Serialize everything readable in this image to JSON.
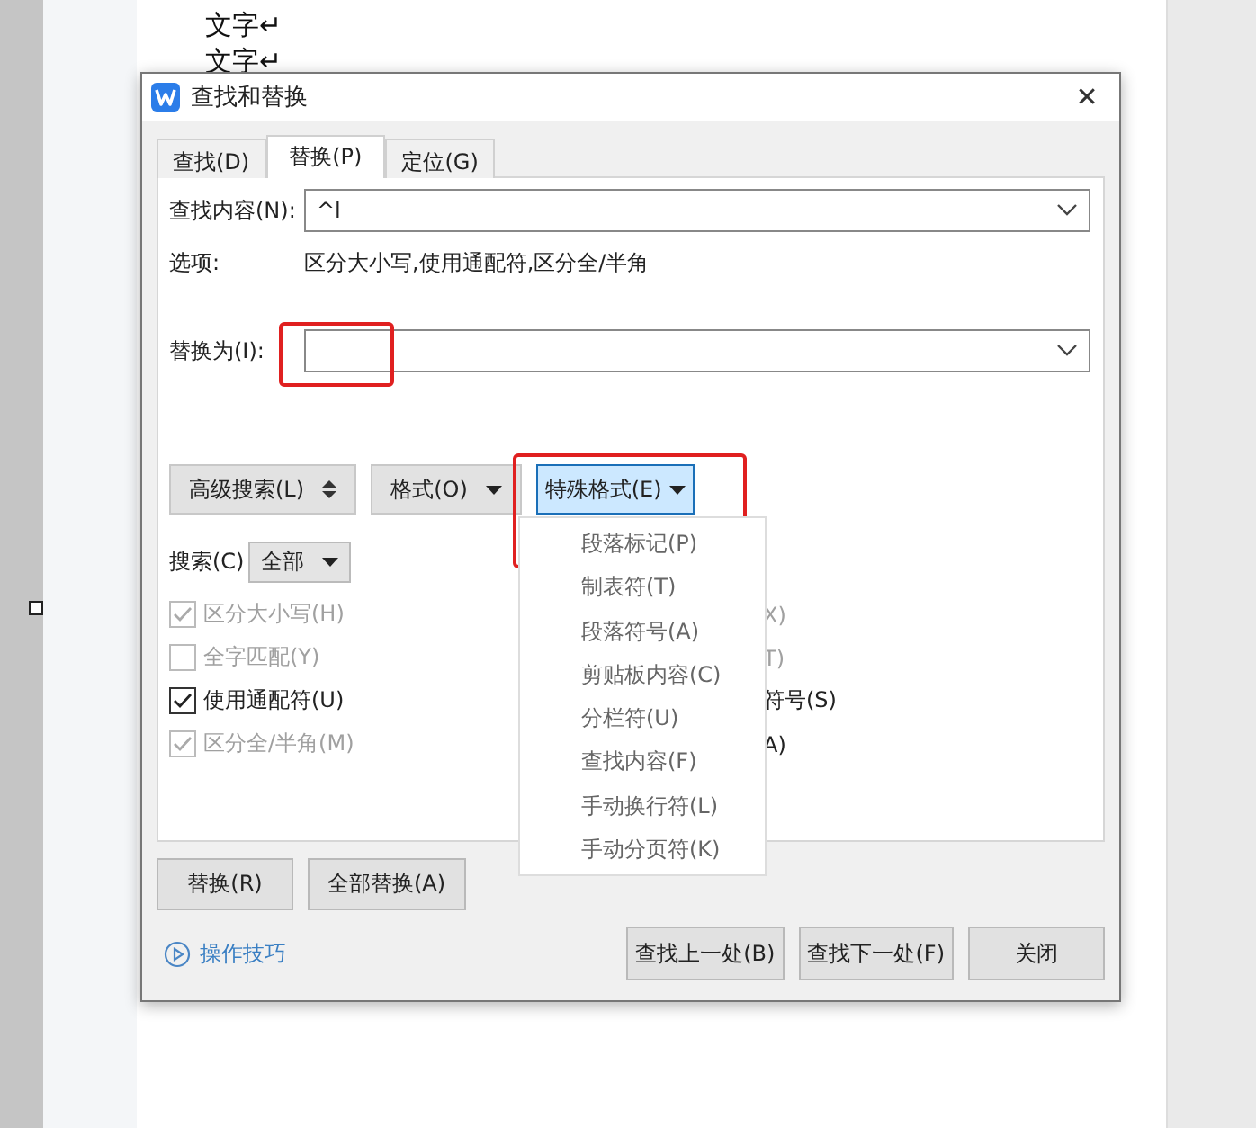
{
  "document": {
    "lines": [
      "文字↵",
      "文字↵"
    ]
  },
  "dialog": {
    "title": "查找和替换",
    "close": "✕",
    "tabs": [
      {
        "label": "查找(D)",
        "selected": false
      },
      {
        "label": "替换(P)",
        "selected": true
      },
      {
        "label": "定位(G)",
        "selected": false
      }
    ],
    "find": {
      "label": "查找内容(N):",
      "value": "^l"
    },
    "options": {
      "label": "选项:",
      "value": "区分大小写,使用通配符,区分全/半角"
    },
    "replace": {
      "label": "替换为(I):",
      "highlighted": true
    },
    "tool_buttons": [
      {
        "label": "高级搜索(L)",
        "kind": "updown",
        "selected": false,
        "highlighted": false
      },
      {
        "label": "格式(O)",
        "kind": "dropdown",
        "selected": false,
        "highlighted": false
      },
      {
        "label": "特殊格式(E)",
        "kind": "dropdown",
        "selected": true,
        "highlighted": true
      }
    ],
    "search": {
      "label": "搜索(C)",
      "value": "全部"
    },
    "checkboxes": [
      {
        "label": "区分大小写(H)",
        "checked": true,
        "disabled": true
      },
      {
        "label": "全字匹配(Y)",
        "checked": false,
        "disabled": true
      },
      {
        "label": "使用通配符(U)",
        "checked": true,
        "disabled": false
      },
      {
        "label": "区分全/半角(M)",
        "checked": true,
        "disabled": true
      }
    ],
    "right_options": [
      {
        "label": "X)",
        "disabled": true
      },
      {
        "label": "T)",
        "disabled": true
      },
      {
        "label": "符号(S)",
        "disabled": false
      },
      {
        "label": "A)",
        "disabled": false
      }
    ],
    "special_menu": {
      "items": [
        "段落标记(P)",
        "制表符(T)",
        "段落符号(A)",
        "剪贴板内容(C)",
        "分栏符(U)",
        "查找内容(F)",
        "手动换行符(L)",
        "手动分页符(K)"
      ]
    },
    "action_buttons": [
      "替换(R)",
      "全部替换(A)"
    ],
    "tips_link": "操作技巧",
    "footer_buttons": [
      "查找上一处(B)",
      "查找下一处(F)",
      "关闭"
    ]
  }
}
